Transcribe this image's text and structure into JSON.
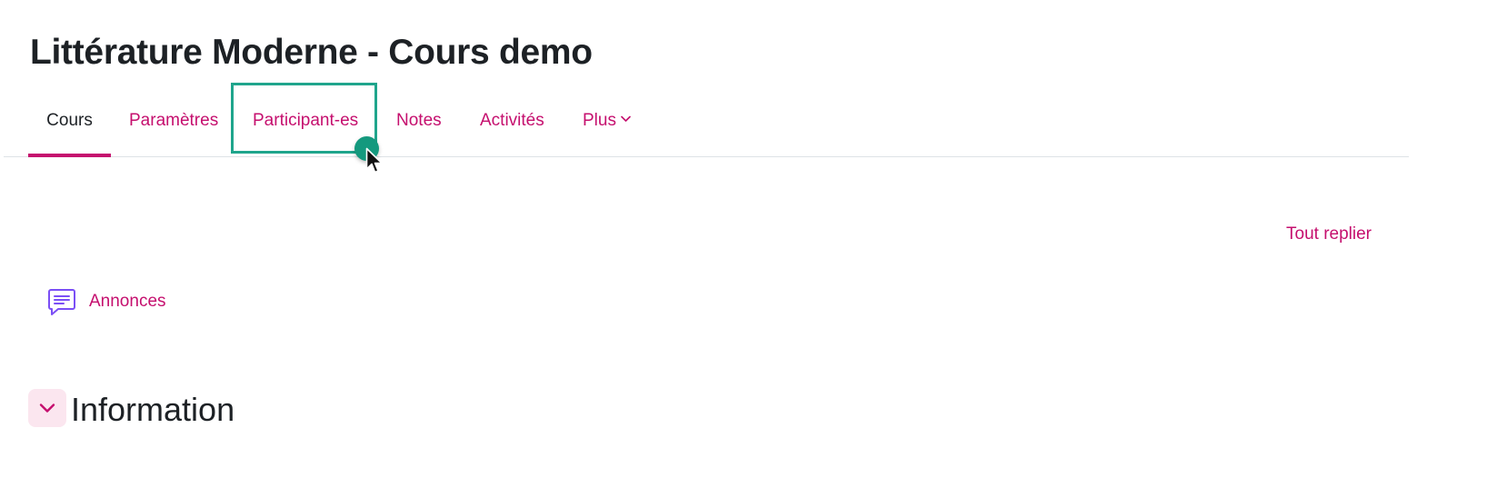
{
  "page": {
    "title": "Littérature Moderne - Cours demo"
  },
  "nav": {
    "tabs": [
      {
        "label": "Cours",
        "active": true
      },
      {
        "label": "Paramètres",
        "active": false
      },
      {
        "label": "Participant-es",
        "active": false
      },
      {
        "label": "Notes",
        "active": false
      },
      {
        "label": "Activités",
        "active": false
      },
      {
        "label": "Plus",
        "active": false,
        "icon": "chevron-down-icon"
      }
    ]
  },
  "actions": {
    "collapse_all": "Tout replier"
  },
  "activities": [
    {
      "label": "Annonces",
      "icon": "forum-icon"
    }
  ],
  "section": {
    "title": "Information",
    "toggle_icon": "chevron-down-icon"
  },
  "colors": {
    "accent": "#c50f6e",
    "text": "#1d2125",
    "icon_purple": "#7b4ff5",
    "highlight": "#1fa58c",
    "toggle_bg": "#fbe6ef"
  }
}
